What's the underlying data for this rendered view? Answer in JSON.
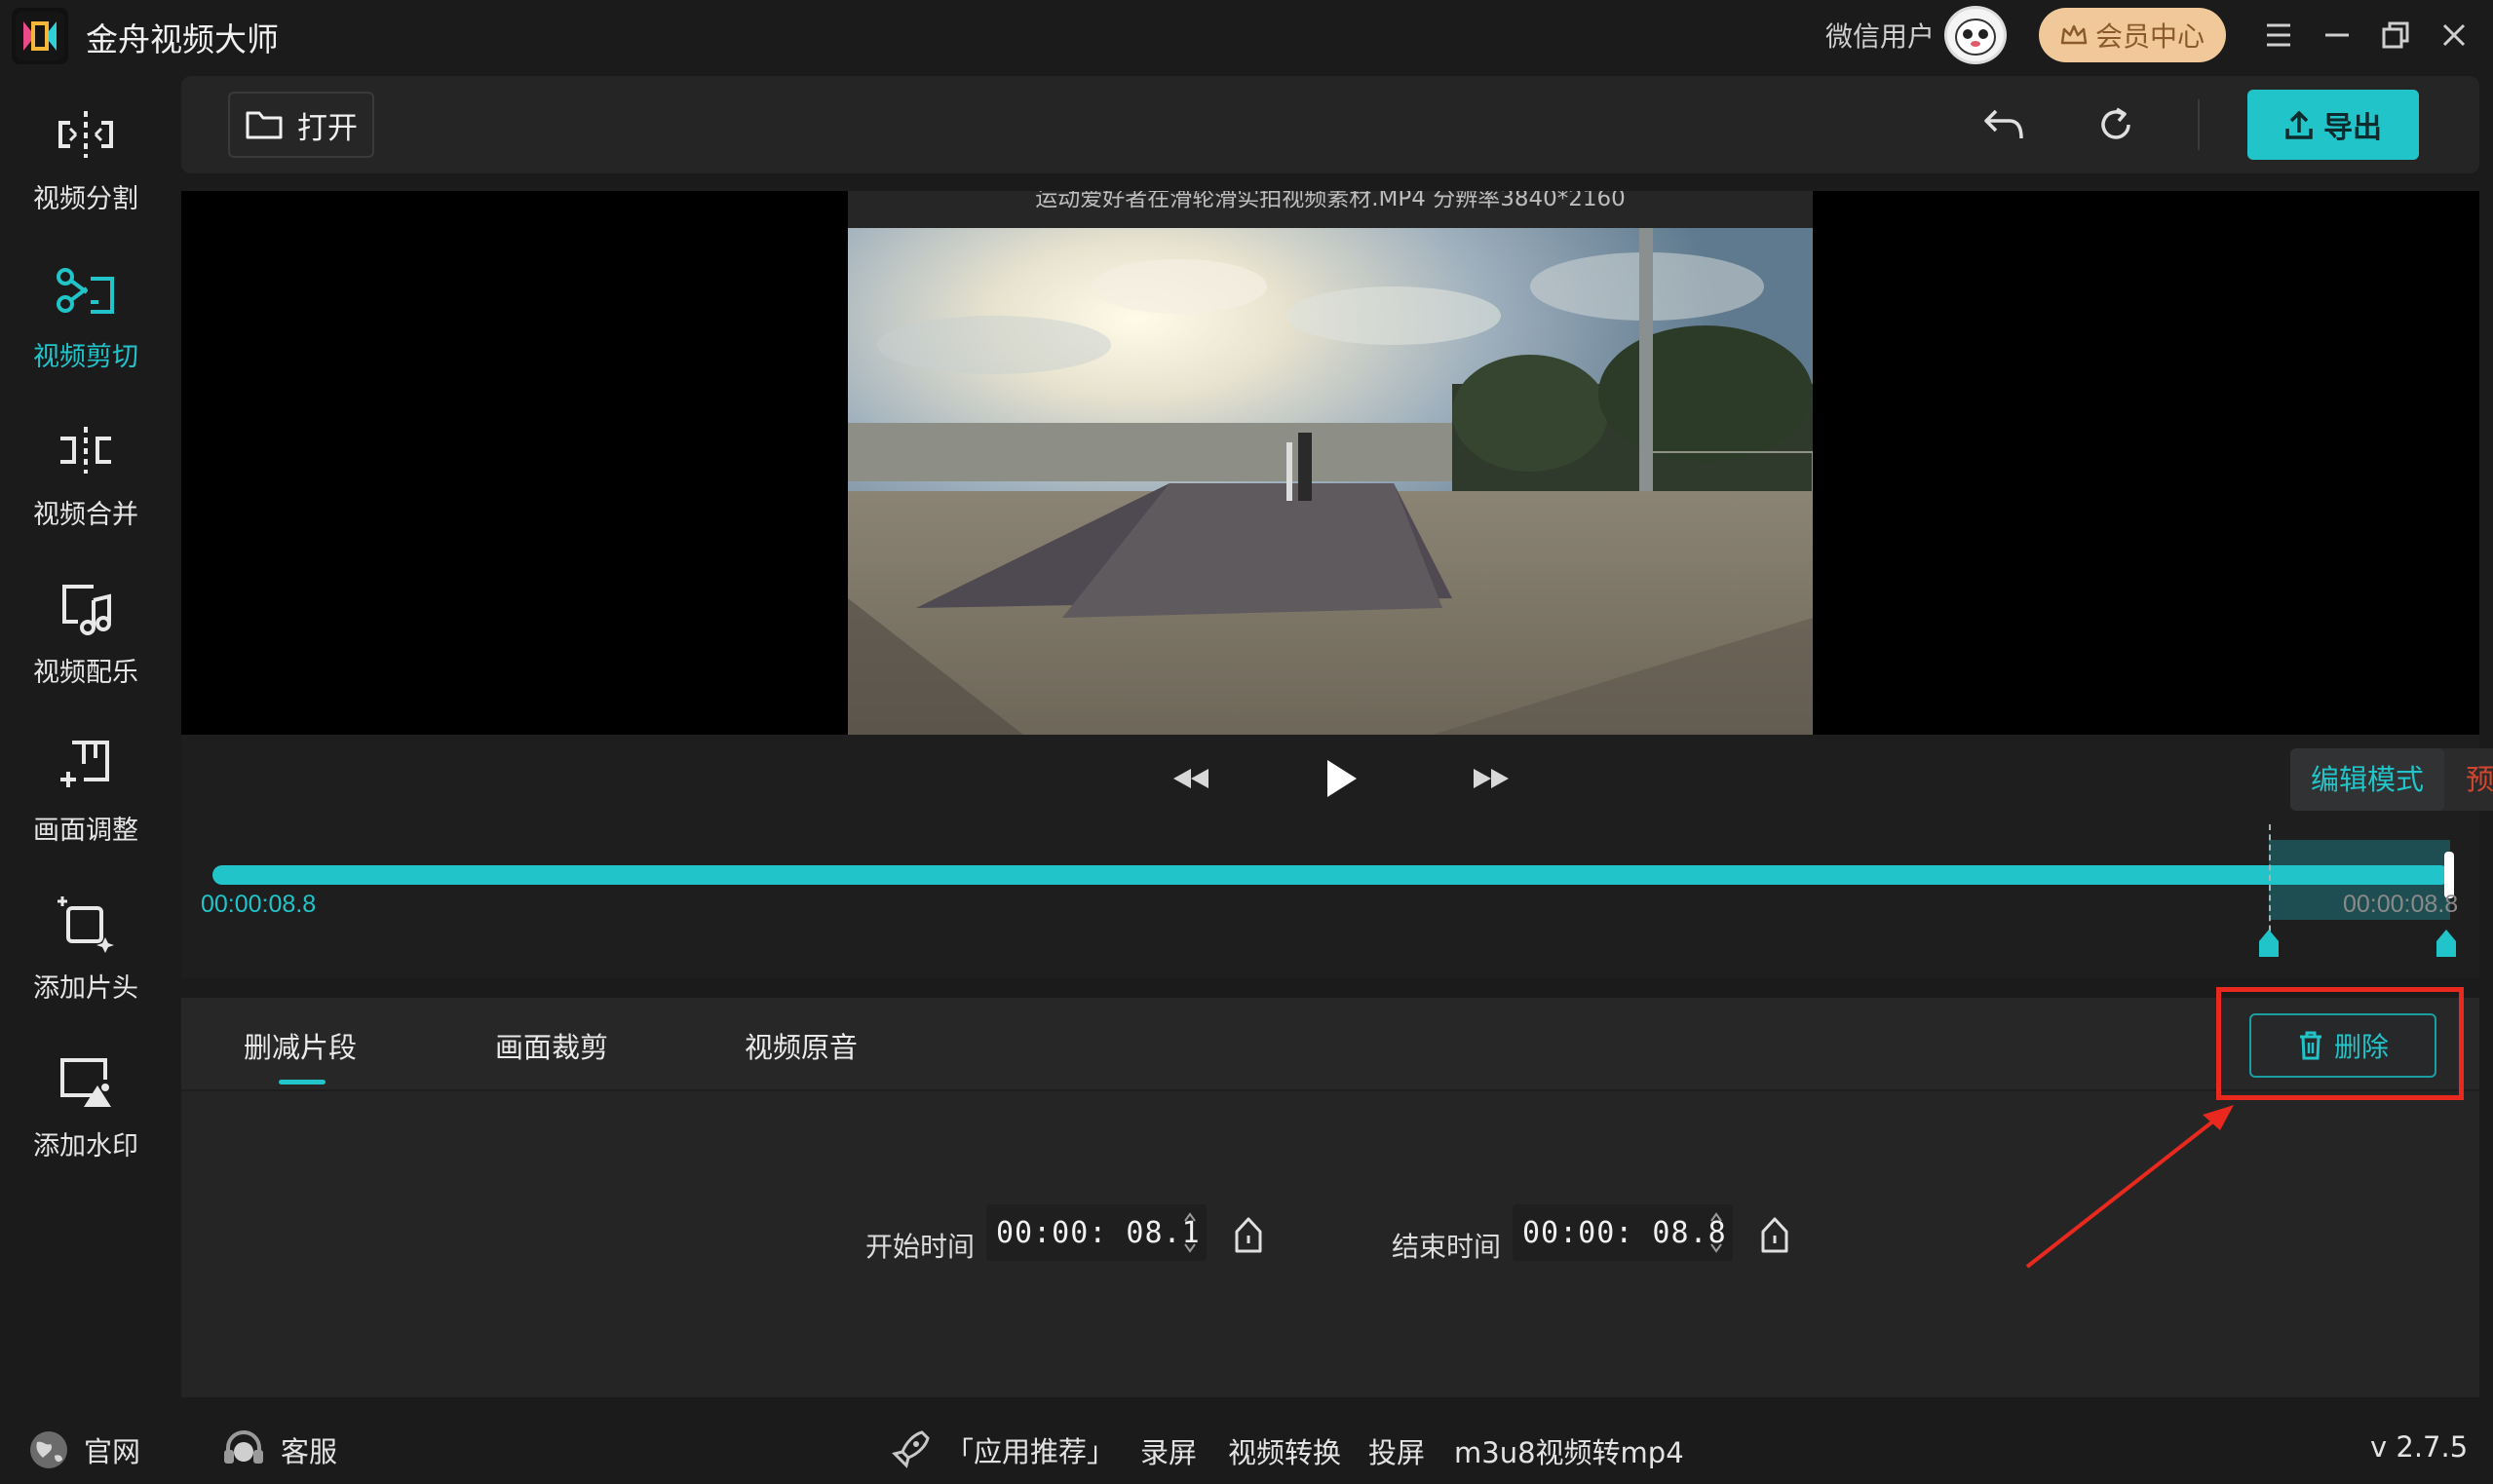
{
  "window": {
    "app_title": "金舟视频大师",
    "user_name": "微信用户",
    "vip_label": "会员中心"
  },
  "sidebar": {
    "items": [
      {
        "label": "视频分割",
        "icon": "split-icon"
      },
      {
        "label": "视频剪切",
        "icon": "scissors-icon",
        "active": true
      },
      {
        "label": "视频合并",
        "icon": "merge-icon"
      },
      {
        "label": "视频配乐",
        "icon": "music-icon"
      },
      {
        "label": "画面调整",
        "icon": "adjust-icon"
      },
      {
        "label": "添加片头",
        "icon": "intro-icon"
      },
      {
        "label": "添加水印",
        "icon": "watermark-icon"
      }
    ]
  },
  "toolbar": {
    "open_label": "打开",
    "export_label": "导出"
  },
  "preview": {
    "caption": "运动爱好者在滑轮滑实拍视频素材.MP4 分辨率3840*2160"
  },
  "playback": {
    "mode_edit": "编辑模式",
    "mode_preview": "预览模式",
    "current_time": "00:00:08.8",
    "end_time": "00:00:08.8",
    "selection_start_fraction": 0.936,
    "selection_end_fraction": 1.0
  },
  "panel": {
    "tabs": [
      {
        "label": "删减片段",
        "active": true
      },
      {
        "label": "画面裁剪"
      },
      {
        "label": "视频原音"
      }
    ],
    "delete_label": "删除",
    "start_label": "开始时间",
    "start_value": "00:00: 08.1",
    "end_label": "结束时间",
    "end_value": "00:00: 08.8"
  },
  "footer": {
    "website": "官网",
    "support": "客服",
    "recommend": "「应用推荐」",
    "links": [
      "录屏",
      "视频转换",
      "投屏",
      "m3u8视频转mp4"
    ],
    "version": "v 2.7.5"
  },
  "colors": {
    "accent": "#21c4c9",
    "preview_mode": "#d2462d",
    "highlight": "#e9281e",
    "vip_bg": "#f1c89a"
  }
}
